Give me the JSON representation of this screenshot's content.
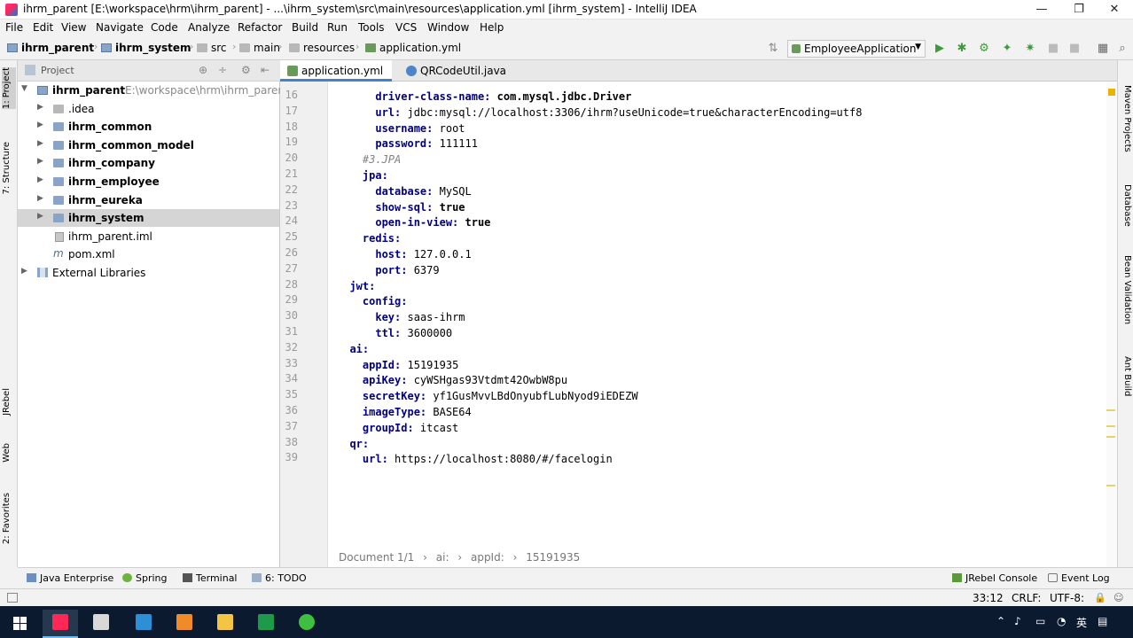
{
  "window": {
    "title": "ihrm_parent [E:\\workspace\\hrm\\ihrm_parent] - ...\\ihrm_system\\src\\main\\resources\\application.yml [ihrm_system] - IntelliJ IDEA",
    "minimize": "—",
    "maximize": "❐",
    "close": "✕"
  },
  "menu": [
    "File",
    "Edit",
    "View",
    "Navigate",
    "Code",
    "Analyze",
    "Refactor",
    "Build",
    "Run",
    "Tools",
    "VCS",
    "Window",
    "Help"
  ],
  "breadcrumbs": [
    "ihrm_parent",
    "ihrm_system",
    "src",
    "main",
    "resources",
    "application.yml"
  ],
  "toolbar": {
    "run_config": "EmployeeApplication"
  },
  "left_strip": {
    "project": "1: Project",
    "structure": "7: Structure",
    "jrebel": "JRebel",
    "web": "Web",
    "favorites": "2: Favorites"
  },
  "right_strip": {
    "maven": "Maven Projects",
    "database": "Database",
    "bean_validation": "Bean Validation",
    "ant_build": "Ant Build"
  },
  "project_panel": {
    "title": "Project",
    "root_name": "ihrm_parent",
    "root_path": "E:\\workspace\\hrm\\ihrm_paren",
    "items": [
      {
        "label": ".idea",
        "bold": false
      },
      {
        "label": "ihrm_common",
        "bold": true
      },
      {
        "label": "ihrm_common_model",
        "bold": true
      },
      {
        "label": "ihrm_company",
        "bold": true
      },
      {
        "label": "ihrm_employee",
        "bold": true
      },
      {
        "label": "ihrm_eureka",
        "bold": true
      },
      {
        "label": "ihrm_system",
        "bold": true
      },
      {
        "label": "ihrm_parent.iml",
        "bold": false
      },
      {
        "label": "pom.xml",
        "bold": false
      }
    ],
    "external": "External Libraries"
  },
  "tabs": [
    {
      "label": "application.yml",
      "active": true
    },
    {
      "label": "QRCodeUtil.java",
      "active": false
    }
  ],
  "code": [
    {
      "n": "16",
      "indent": "      ",
      "key": "driver-class-name:",
      "val": " com.mysql.jdbc.Driver",
      "bold_val": true
    },
    {
      "n": "17",
      "indent": "      ",
      "key": "url:",
      "val": " jdbc:mysql://localhost:3306/ihrm?useUnicode=true&characterEncoding=utf8"
    },
    {
      "n": "18",
      "indent": "      ",
      "key": "username:",
      "val": " root"
    },
    {
      "n": "19",
      "indent": "      ",
      "key": "password:",
      "val": " 111111"
    },
    {
      "n": "20",
      "indent": "    ",
      "comment": "#3.JPA"
    },
    {
      "n": "21",
      "indent": "    ",
      "key": "jpa:",
      "val": ""
    },
    {
      "n": "22",
      "indent": "      ",
      "key": "database:",
      "val": " MySQL"
    },
    {
      "n": "23",
      "indent": "      ",
      "key": "show-sql:",
      "val": " true",
      "bold_val": true
    },
    {
      "n": "24",
      "indent": "      ",
      "key": "open-in-view:",
      "val": " true",
      "bold_val": true
    },
    {
      "n": "25",
      "indent": "    ",
      "key": "redis:",
      "val": ""
    },
    {
      "n": "26",
      "indent": "      ",
      "key": "host:",
      "val": " 127.0.0.1"
    },
    {
      "n": "27",
      "indent": "      ",
      "key": "port:",
      "val": " 6379"
    },
    {
      "n": "28",
      "indent": "  ",
      "key": "jwt:",
      "val": ""
    },
    {
      "n": "29",
      "indent": "    ",
      "key": "config:",
      "val": ""
    },
    {
      "n": "30",
      "indent": "      ",
      "key": "key:",
      "val": " saas-ihrm"
    },
    {
      "n": "31",
      "indent": "      ",
      "key": "ttl:",
      "val": " 3600000"
    },
    {
      "n": "32",
      "indent": "  ",
      "key": "ai:",
      "val": ""
    },
    {
      "n": "33",
      "indent": "    ",
      "key": "appId:",
      "val": " 15191935"
    },
    {
      "n": "34",
      "indent": "    ",
      "key": "apiKey:",
      "val": " cyWSHgas93Vtdmt42OwbW8pu"
    },
    {
      "n": "35",
      "indent": "    ",
      "key": "secretKey:",
      "val": " yf1GusMvvLBdOnyubfLubNyod9iEDEZW"
    },
    {
      "n": "36",
      "indent": "    ",
      "key": "imageType:",
      "val": " BASE64"
    },
    {
      "n": "37",
      "indent": "    ",
      "key": "groupId:",
      "val": " itcast"
    },
    {
      "n": "38",
      "indent": "  ",
      "key": "qr:",
      "val": ""
    },
    {
      "n": "39",
      "indent": "    ",
      "key": "url:",
      "val": " https://localhost:8080/#/facelogin"
    }
  ],
  "editor_breadcrumb": {
    "doc": "Document 1/1",
    "sep": "›",
    "p1": "ai:",
    "p2": "appId:",
    "p3": "15191935"
  },
  "bottom_tabs": {
    "java_enterprise": "Java Enterprise",
    "spring": "Spring",
    "terminal": "Terminal",
    "todo": "6: TODO",
    "jrebel_console": "JRebel Console",
    "event_log": "Event Log"
  },
  "status": {
    "position": "33:12",
    "line_sep": "CRLF:",
    "encoding": "UTF-8:"
  },
  "colors": {
    "key": "#000080",
    "accent": "#4083c9",
    "taskbar": "#0b1a2e"
  }
}
